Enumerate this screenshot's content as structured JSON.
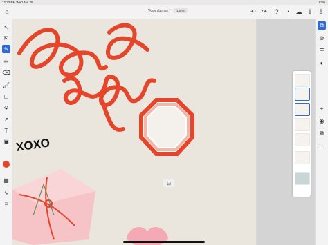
{
  "status": {
    "time": "12:33 PM",
    "date": "Wed Jan 25",
    "battery": "83%"
  },
  "app": {
    "doc_title": "Vday stamps *",
    "zoom": "138%"
  },
  "left_tools": [
    {
      "name": "home-icon",
      "glyph": "⌂"
    },
    {
      "name": "select-icon",
      "glyph": "↖"
    },
    {
      "name": "direct-select-icon",
      "glyph": "⇱"
    },
    {
      "name": "pen-icon",
      "glyph": "✎",
      "active": true
    },
    {
      "name": "pencil-icon",
      "glyph": "✏"
    },
    {
      "name": "eraser-icon",
      "glyph": "⌫"
    },
    {
      "name": "brush-icon",
      "glyph": "🖌"
    },
    {
      "name": "shape-icon",
      "glyph": "◻"
    },
    {
      "name": "paint-bucket-icon",
      "glyph": "⬙"
    },
    {
      "name": "type-icon",
      "glyph": "T"
    },
    {
      "name": "image-icon",
      "glyph": "▣"
    },
    {
      "name": "color-swatch-icon",
      "glyph": ""
    },
    {
      "name": "grid-icon",
      "glyph": "▦"
    },
    {
      "name": "wave-icon",
      "glyph": "∿"
    },
    {
      "name": "menu-icon",
      "glyph": "≡"
    }
  ],
  "right_tools": [
    {
      "name": "layers-icon",
      "glyph": "⧉",
      "active": true
    },
    {
      "name": "properties-icon",
      "glyph": "⚙"
    },
    {
      "name": "align-icon",
      "glyph": "☰"
    },
    {
      "name": "appearance-icon",
      "glyph": "◐"
    },
    {
      "name": "effects-icon",
      "glyph": "✦"
    },
    {
      "name": "add-layer-icon",
      "glyph": "+"
    },
    {
      "name": "visibility-icon",
      "glyph": "◉"
    },
    {
      "name": "more-icon",
      "glyph": "⋯"
    }
  ],
  "canvas": {
    "script_text": "Love You",
    "xoxo": "XOXO",
    "accent": "#e5452b",
    "peach": "#f4b6a7"
  }
}
